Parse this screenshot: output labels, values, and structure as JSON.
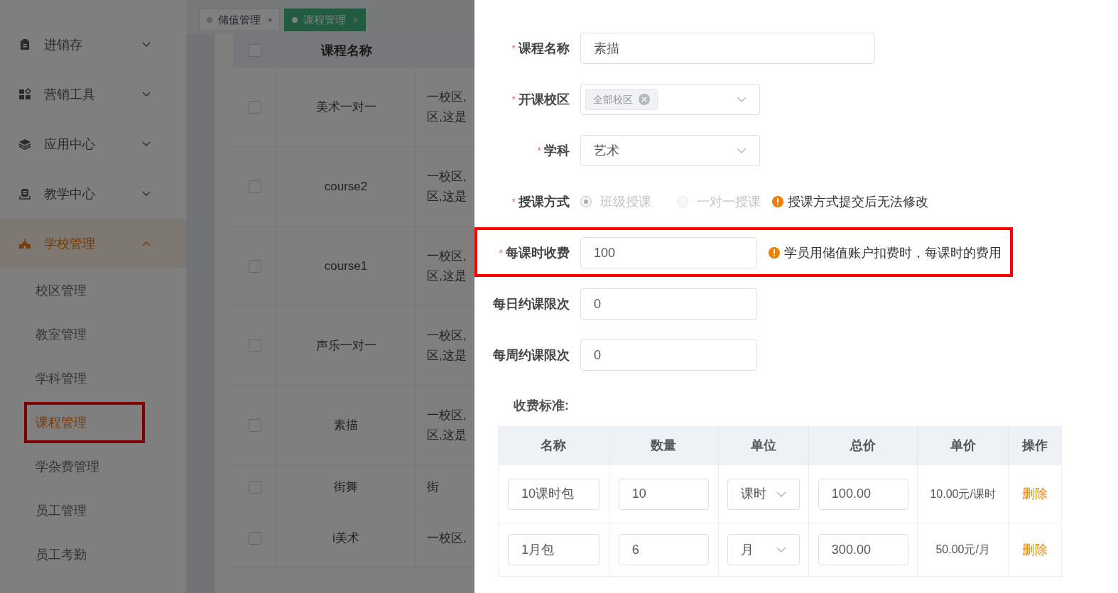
{
  "sidebar": {
    "items": [
      {
        "label": "进销存",
        "expanded": false,
        "selected": false
      },
      {
        "label": "营销工具",
        "expanded": false,
        "selected": false
      },
      {
        "label": "应用中心",
        "expanded": false,
        "selected": false
      },
      {
        "label": "教学中心",
        "expanded": false,
        "selected": false
      },
      {
        "label": "学校管理",
        "expanded": true,
        "selected": true,
        "children": [
          {
            "label": "校区管理",
            "selected": false,
            "highlighted": false
          },
          {
            "label": "教室管理",
            "selected": false,
            "highlighted": false
          },
          {
            "label": "学科管理",
            "selected": false,
            "highlighted": false
          },
          {
            "label": "课程管理",
            "selected": true,
            "highlighted": true
          },
          {
            "label": "学杂费管理",
            "selected": false,
            "highlighted": false
          },
          {
            "label": "员工管理",
            "selected": false,
            "highlighted": false
          },
          {
            "label": "员工考勤",
            "selected": false,
            "highlighted": false
          }
        ]
      }
    ]
  },
  "tabs": [
    {
      "label": "储值管理",
      "selected": false,
      "close": "×"
    },
    {
      "label": "课程管理",
      "selected": true,
      "close": "×"
    }
  ],
  "table": {
    "select_all_checked": false,
    "columns": [
      "课程名称"
    ],
    "rows": [
      {
        "checked": false,
        "name": "美术一对一",
        "column_3": [
          "一校区,",
          "区,这是"
        ]
      },
      {
        "checked": false,
        "name": "course2",
        "column_3": [
          "一校区,",
          "区,这是"
        ]
      },
      {
        "checked": false,
        "name": "course1",
        "column_3": [
          "一校区,",
          "区,这是"
        ]
      },
      {
        "checked": false,
        "name": "声乐一对一",
        "column_3": [
          "一校区,",
          "区,这是"
        ]
      },
      {
        "checked": false,
        "name": "素描",
        "column_3": [
          "一校区,",
          "区,这是"
        ]
      },
      {
        "checked": false,
        "name": "街舞",
        "column_3": [
          "街"
        ]
      },
      {
        "checked": false,
        "name": "i美术",
        "column_3": [
          "一校区,"
        ]
      }
    ]
  },
  "form": {
    "fields": [
      {
        "kind": "long_text",
        "label": "课程名称",
        "marker": "*",
        "value": "素描"
      },
      {
        "kind": "tags",
        "label": "开课校区",
        "marker": "*",
        "tags": [
          "全部校区"
        ]
      },
      {
        "kind": "select",
        "label": "学科",
        "marker": "*",
        "value": "艺术"
      },
      {
        "kind": "radio",
        "label": "授课方式",
        "marker": "*",
        "disabled": true,
        "options": [
          {
            "label": "班级授课",
            "selected": true
          },
          {
            "label": "一对一授课",
            "selected": false
          }
        ],
        "hint": "授课方式提交后无法修改"
      },
      {
        "kind": "text",
        "label": "每课时收费",
        "marker": "*",
        "value": "100",
        "hint": "学员用储值账户扣费时，每课时的费用",
        "highlighted": true
      },
      {
        "kind": "text",
        "label": "每日约课限次",
        "value": "0"
      },
      {
        "kind": "text",
        "label": "每周约课限次",
        "value": "0"
      }
    ],
    "fee_title": "收费标准:",
    "fee_table": {
      "columns": [
        "名称",
        "数量",
        "单位",
        "总价",
        "单价",
        "操作"
      ],
      "rows": [
        {
          "name": "10课时包",
          "quantity": "10",
          "unit": "课时",
          "total": "100.00",
          "unit_price": "10.00元/课时",
          "action": "删除"
        },
        {
          "name": "1月包",
          "quantity": "6",
          "unit": "月",
          "total": "300.00",
          "unit_price": "50.00元/月",
          "action": "删除"
        }
      ]
    }
  }
}
